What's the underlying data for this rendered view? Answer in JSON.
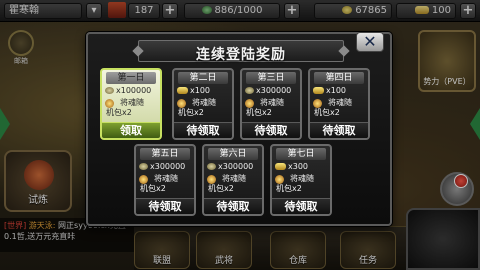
{
  "topbar": {
    "player_name": "瞿寒翰",
    "level": "187",
    "stamina": "886/1000",
    "coins": "67865",
    "ingots": "100"
  },
  "side": {
    "mail_label": "邮箱",
    "trial_label": "试炼",
    "pve_label": "势力（PVE）"
  },
  "chat": {
    "channel": "[世界]",
    "name": "游天泳:",
    "message": "网正syy66.cn充直0.1哲,送万元充直咔"
  },
  "bottom": {
    "items": [
      "联盟",
      "武将",
      "仓库",
      "任务"
    ]
  },
  "dialog": {
    "title": "连续登陆奖励",
    "close": "✕",
    "cards": [
      {
        "day": "第一日",
        "amount": "x100000",
        "soul_line1": "将魂随",
        "soul_line2": "机包x2",
        "button": "领取",
        "active": true
      },
      {
        "day": "第二日",
        "amount": "x100",
        "soul_line1": "将魂随",
        "soul_line2": "机包x2",
        "button": "待领取",
        "active": false
      },
      {
        "day": "第三日",
        "amount": "x300000",
        "soul_line1": "将魂随",
        "soul_line2": "机包x2",
        "button": "待领取",
        "active": false
      },
      {
        "day": "第四日",
        "amount": "x100",
        "soul_line1": "将魂随",
        "soul_line2": "机包x2",
        "button": "待领取",
        "active": false
      },
      {
        "day": "第五日",
        "amount": "x300000",
        "soul_line1": "将魂随",
        "soul_line2": "机包x2",
        "button": "待领取",
        "active": false
      },
      {
        "day": "第六日",
        "amount": "x300000",
        "soul_line1": "将魂随",
        "soul_line2": "机包x2",
        "button": "待领取",
        "active": false
      },
      {
        "day": "第七日",
        "amount": "x300",
        "soul_line1": "将魂随",
        "soul_line2": "机包x2",
        "button": "待领取",
        "active": false
      }
    ]
  }
}
